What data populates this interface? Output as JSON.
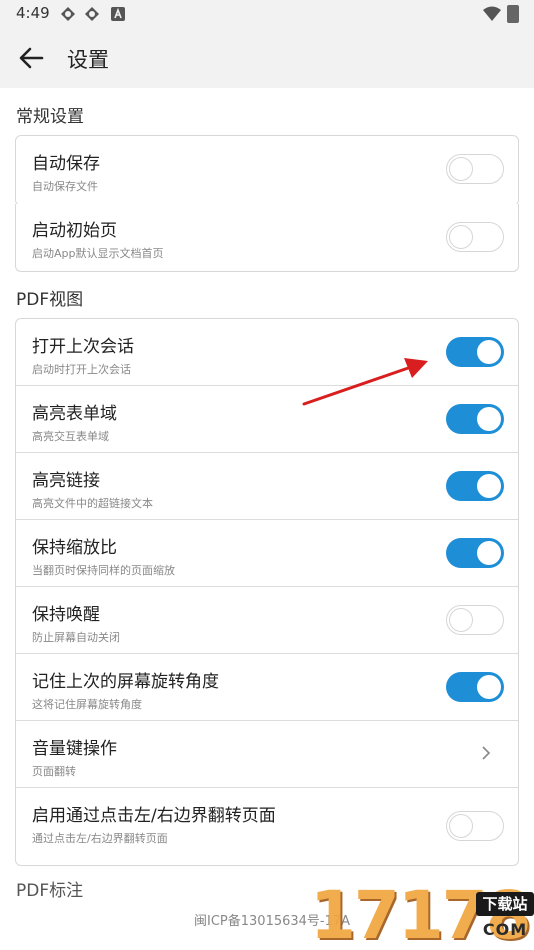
{
  "status_bar": {
    "time": "4:49",
    "icons": [
      "app-notification-icon",
      "app-notification-icon",
      "a-notification-icon",
      "wifi-icon",
      "battery-icon"
    ]
  },
  "header": {
    "title": "设置",
    "back_icon": "arrow-left-icon"
  },
  "sections": {
    "general": {
      "title": "常规设置",
      "items": [
        {
          "label": "自动保存",
          "desc": "自动保存文件",
          "toggle": "off"
        },
        {
          "label": "启动初始页",
          "desc": "启动App默认显示文档首页",
          "toggle": "off"
        }
      ]
    },
    "pdf_view": {
      "title": "PDF视图",
      "items": [
        {
          "label": "打开上次会话",
          "desc": "启动时打开上次会话",
          "toggle": "on"
        },
        {
          "label": "高亮表单域",
          "desc": "高亮交互表单域",
          "toggle": "on"
        },
        {
          "label": "高亮链接",
          "desc": "高亮文件中的超链接文本",
          "toggle": "on"
        },
        {
          "label": "保持缩放比",
          "desc": "当翻页时保持同样的页面缩放",
          "toggle": "on"
        },
        {
          "label": "保持唤醒",
          "desc": "防止屏幕自动关闭",
          "toggle": "off"
        },
        {
          "label": "记住上次的屏幕旋转角度",
          "desc": "这将记住屏幕旋转角度",
          "toggle": "on"
        },
        {
          "label": "音量键操作",
          "desc": "页面翻转",
          "toggle": "chevron"
        },
        {
          "label": "启用通过点击左/右边界翻转页面",
          "desc": "通过点击左/右边界翻转页面",
          "toggle": "off"
        }
      ]
    },
    "pdf_annotation": {
      "title": "PDF标注"
    }
  },
  "footer": {
    "icp": "闽ICP备13015634号-17A"
  },
  "watermark": {
    "number": "17178",
    "badge": "下载站",
    "suffix": "COM"
  },
  "colors": {
    "accent": "#1e8fd6",
    "arrow": "#d81e1e",
    "watermark": "#f0a640"
  }
}
